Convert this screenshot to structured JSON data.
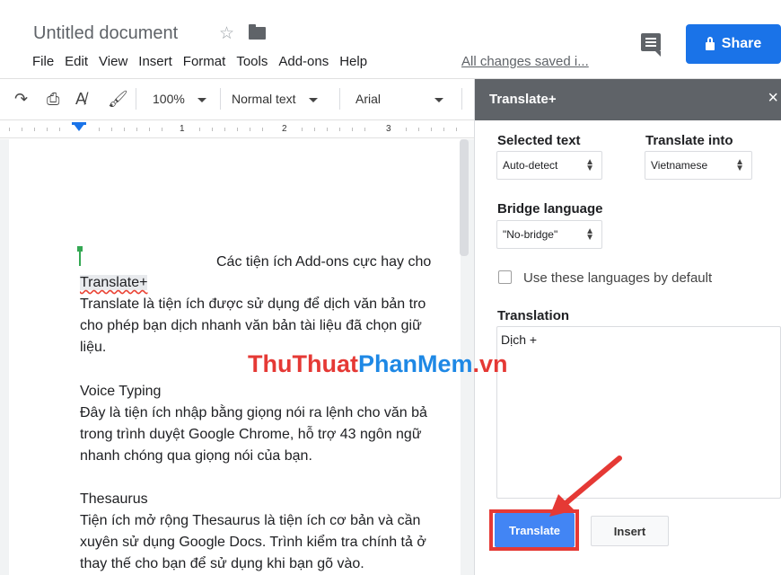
{
  "header": {
    "title": "Untitled document",
    "star_icon": "star-outline-icon",
    "folder_icon": "folder-icon",
    "menu": [
      "File",
      "Edit",
      "View",
      "Insert",
      "Format",
      "Tools",
      "Add-ons",
      "Help"
    ],
    "saved_status": "All changes saved i...",
    "share_label": "Share",
    "share_color": "#1a73e8"
  },
  "toolbar": {
    "zoom": "100%",
    "style": "Normal text",
    "font": "Arial"
  },
  "ruler": {
    "marks": [
      "1",
      "2",
      "3"
    ]
  },
  "document": {
    "line1": "Các tiện ích Add-ons cực hay cho",
    "heading1": "Translate+",
    "para1_l1": "Translate là tiện ích được sử dụng để dịch văn bản tro",
    "para1_l2": "cho phép bạn dịch nhanh văn bản tài liệu đã chọn giữ",
    "para1_l3": "liệu.",
    "heading2": "Voice Typing",
    "para2_l1": "Đây là tiện ích nhập bằng giọng nói ra lệnh cho văn bả",
    "para2_l2": "trong trình duyệt Google Chrome, hỗ trợ 43 ngôn ngữ",
    "para2_l3": "nhanh chóng qua giọng nói của bạn.",
    "heading3": "Thesaurus",
    "para3_l1": "Tiện ích mở rộng Thesaurus là tiện ích cơ bản và cần",
    "para3_l2": "xuyên sử dụng Google Docs. Trình kiểm tra chính tả ở",
    "para3_l3": "thay thế cho bạn để sử dụng khi bạn gõ vào."
  },
  "watermark": {
    "part1": "ThuThuat",
    "part2": "PhanMem",
    "part3": ".vn"
  },
  "panel": {
    "title": "Translate+",
    "selected_text_label": "Selected text",
    "selected_text_value": "Auto-detect",
    "translate_into_label": "Translate into",
    "translate_into_value": "Vietnamese",
    "bridge_label": "Bridge language",
    "bridge_value": "\"No-bridge\"",
    "default_checkbox_label": "Use these languages by default",
    "translation_label": "Translation",
    "translation_value": "Dịch +",
    "translate_button": "Translate",
    "insert_button": "Insert",
    "highlight_color": "#e53935"
  }
}
